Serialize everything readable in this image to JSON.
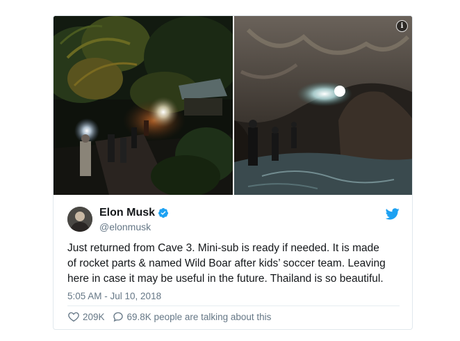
{
  "tweet": {
    "display_name": "Elon Musk",
    "handle": "@elonmusk",
    "text": "Just returned from Cave 3. Mini-sub is ready if needed. It is made\nof rocket parts & named Wild Boar after kids’ soccer team. Leaving\nhere in case it may be useful in the future. Thailand is so beautiful.",
    "timestamp": "5:05 AM - Jul 10, 2018",
    "likes": "209K",
    "talking": "69.8K people are talking about this"
  },
  "icons": {
    "info": "info-icon",
    "verified": "verified-badge-icon",
    "twitter": "twitter-bird-icon",
    "like": "heart-icon",
    "reply": "speech-bubble-icon"
  },
  "colors": {
    "twitter_blue": "#1da1f2",
    "text": "#14171a",
    "secondary_text": "#657786",
    "border": "#e1e8ed"
  }
}
